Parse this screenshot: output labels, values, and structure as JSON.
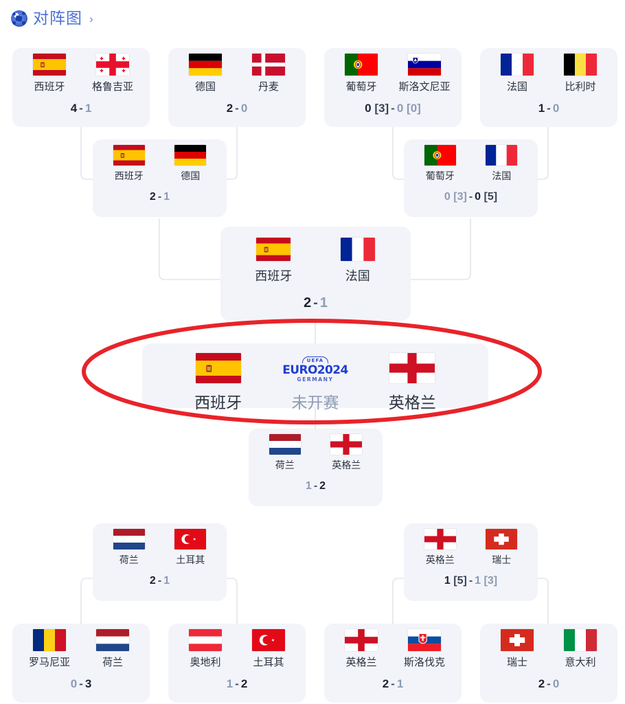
{
  "header": {
    "icon": "soccer-ball-icon",
    "title": "对阵图",
    "chevron": "›"
  },
  "logo": {
    "uefa": "UEFA",
    "main": "EURO2024",
    "sub": "GERMANY"
  },
  "colors": {
    "card_bg": "#f3f4f9",
    "title_blue": "#4b6fd8",
    "annotation_red": "#e8232a",
    "score_dark": "#1d2430",
    "score_light": "#8d9bb4",
    "connector": "#e3e5ea"
  },
  "annotation": {
    "shape": "ellipse",
    "color": "#e8232a",
    "target": "final-match"
  },
  "rounds": {
    "r16_top": [
      {
        "id": "r16-t1",
        "home": {
          "name": "西班牙",
          "flag": "spain",
          "score": "4",
          "winner": true
        },
        "away": {
          "name": "格鲁吉亚",
          "flag": "georgia",
          "score": "1",
          "winner": false
        },
        "score_text": "4 - 1"
      },
      {
        "id": "r16-t2",
        "home": {
          "name": "德国",
          "flag": "germany",
          "score": "2",
          "winner": true
        },
        "away": {
          "name": "丹麦",
          "flag": "denmark",
          "score": "0",
          "winner": false
        },
        "score_text": "2 - 0"
      },
      {
        "id": "r16-t3",
        "home": {
          "name": "葡萄牙",
          "flag": "portugal",
          "score": "0",
          "pens": "[3]",
          "winner": true
        },
        "away": {
          "name": "斯洛文尼亚",
          "flag": "slovenia",
          "score": "0",
          "pens": "[0]",
          "winner": false
        },
        "score_text": "0 [3] - 0 [0]"
      },
      {
        "id": "r16-t4",
        "home": {
          "name": "法国",
          "flag": "france",
          "score": "1",
          "winner": true
        },
        "away": {
          "name": "比利时",
          "flag": "belgium",
          "score": "0",
          "winner": false
        },
        "score_text": "1 - 0"
      }
    ],
    "qf_top": [
      {
        "id": "qf-t1",
        "home": {
          "name": "西班牙",
          "flag": "spain",
          "score": "2",
          "winner": true
        },
        "away": {
          "name": "德国",
          "flag": "germany",
          "score": "1",
          "winner": false
        },
        "score_text": "2 - 1"
      },
      {
        "id": "qf-t2",
        "home": {
          "name": "葡萄牙",
          "flag": "portugal",
          "score": "0",
          "pens": "[3]",
          "winner": false
        },
        "away": {
          "name": "法国",
          "flag": "france",
          "score": "0",
          "pens": "[5]",
          "winner": true
        },
        "score_text": "0 [3] - 0 [5]"
      }
    ],
    "sf_top": [
      {
        "id": "sf-t1",
        "home": {
          "name": "西班牙",
          "flag": "spain",
          "score": "2",
          "winner": true
        },
        "away": {
          "name": "法国",
          "flag": "france",
          "score": "1",
          "winner": false
        },
        "score_text": "2 - 1"
      }
    ],
    "final": {
      "id": "final",
      "home": {
        "name": "西班牙",
        "flag": "spain"
      },
      "away": {
        "name": "英格兰",
        "flag": "england"
      },
      "status": "未开赛"
    },
    "sf_bottom": [
      {
        "id": "sf-b1",
        "home": {
          "name": "荷兰",
          "flag": "netherlands",
          "score": "1",
          "winner": false
        },
        "away": {
          "name": "英格兰",
          "flag": "england",
          "score": "2",
          "winner": true
        },
        "score_text": "1 - 2"
      }
    ],
    "qf_bottom": [
      {
        "id": "qf-b1",
        "home": {
          "name": "荷兰",
          "flag": "netherlands",
          "score": "2",
          "winner": true
        },
        "away": {
          "name": "土耳其",
          "flag": "turkey",
          "score": "1",
          "winner": false
        },
        "score_text": "2 - 1"
      },
      {
        "id": "qf-b2",
        "home": {
          "name": "英格兰",
          "flag": "england",
          "score": "1",
          "pens": "[5]",
          "winner": true
        },
        "away": {
          "name": "瑞士",
          "flag": "switzerland",
          "score": "1",
          "pens": "[3]",
          "winner": false
        },
        "score_text": "1 [5] - 1 [3]"
      }
    ],
    "r16_bottom": [
      {
        "id": "r16-b1",
        "home": {
          "name": "罗马尼亚",
          "flag": "romania",
          "score": "0",
          "winner": false
        },
        "away": {
          "name": "荷兰",
          "flag": "netherlands",
          "score": "3",
          "winner": true
        },
        "score_text": "0 - 3"
      },
      {
        "id": "r16-b2",
        "home": {
          "name": "奥地利",
          "flag": "austria",
          "score": "1",
          "winner": false
        },
        "away": {
          "name": "土耳其",
          "flag": "turkey",
          "score": "2",
          "winner": true
        },
        "score_text": "1 - 2"
      },
      {
        "id": "r16-b3",
        "home": {
          "name": "英格兰",
          "flag": "england",
          "score": "2",
          "winner": true
        },
        "away": {
          "name": "斯洛伐克",
          "flag": "slovakia",
          "score": "1",
          "winner": false
        },
        "score_text": "2 - 1"
      },
      {
        "id": "r16-b4",
        "home": {
          "name": "瑞士",
          "flag": "switzerland",
          "score": "2",
          "winner": true
        },
        "away": {
          "name": "意大利",
          "flag": "italy",
          "score": "0",
          "winner": false
        },
        "score_text": "2 - 0"
      }
    ]
  }
}
